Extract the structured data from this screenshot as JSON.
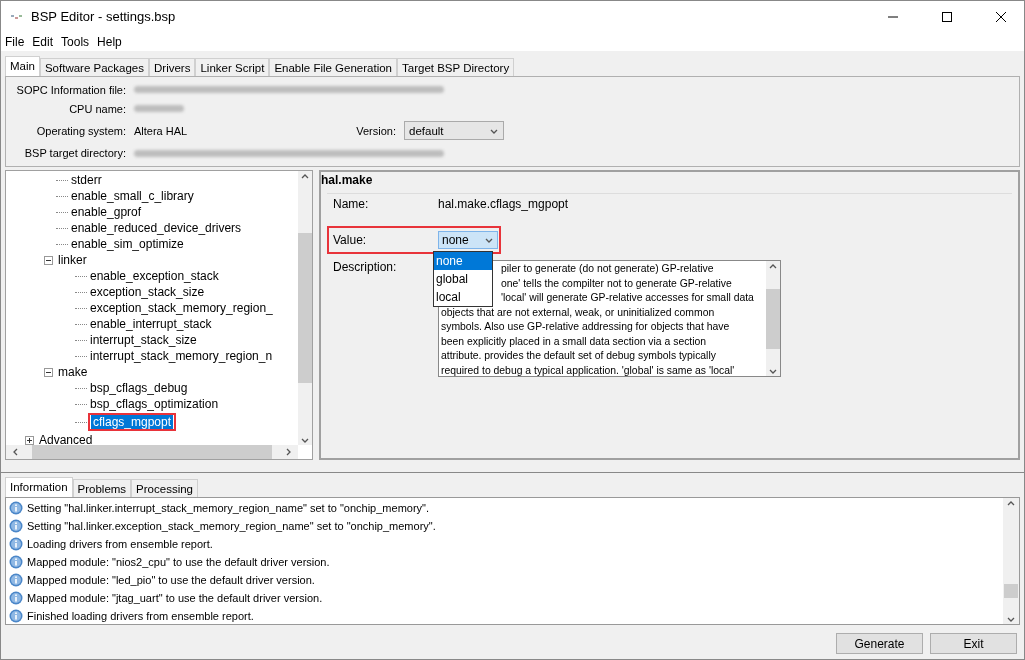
{
  "window": {
    "title": "BSP Editor - settings.bsp"
  },
  "menu": [
    "File",
    "Edit",
    "Tools",
    "Help"
  ],
  "tabs": [
    {
      "label": "Main",
      "selected": true
    },
    {
      "label": "Software Packages",
      "selected": false
    },
    {
      "label": "Drivers",
      "selected": false
    },
    {
      "label": "Linker Script",
      "selected": false
    },
    {
      "label": "Enable File Generation",
      "selected": false
    },
    {
      "label": "Target BSP Directory",
      "selected": false
    }
  ],
  "info": [
    {
      "label": "SOPC Information file:",
      "kind": "blurred"
    },
    {
      "label": "CPU name:",
      "kind": "blurred"
    },
    {
      "label": "Operating system:",
      "kind": "text",
      "value": "Altera HAL",
      "extra_label": "Version:",
      "extra_value": "default"
    },
    {
      "label": "BSP target directory:",
      "kind": "blurred"
    }
  ],
  "tree": {
    "scrolled_branch": [
      {
        "label": "stderr",
        "selected": false
      },
      {
        "label": "enable_small_c_library",
        "selected": false
      },
      {
        "label": "enable_gprof",
        "selected": false
      },
      {
        "label": "enable_reduced_device_drivers",
        "selected": false
      },
      {
        "label": "enable_sim_optimize",
        "selected": false
      },
      {
        "label": "linker",
        "selected": false,
        "expanded": true,
        "children": [
          {
            "label": "enable_exception_stack",
            "selected": false
          },
          {
            "label": "exception_stack_size",
            "selected": false
          },
          {
            "label": "exception_stack_memory_region_",
            "selected": false
          },
          {
            "label": "enable_interrupt_stack",
            "selected": false
          },
          {
            "label": "interrupt_stack_size",
            "selected": false
          },
          {
            "label": "interrupt_stack_memory_region_n",
            "selected": false
          }
        ]
      },
      {
        "label": "make",
        "selected": false,
        "expanded": true,
        "children": [
          {
            "label": "bsp_cflags_debug",
            "selected": false
          },
          {
            "label": "bsp_cflags_optimization",
            "selected": false
          },
          {
            "label": "cflags_mgpopt",
            "selected": true,
            "highlighted": true
          }
        ]
      }
    ],
    "roots": [
      {
        "label": "Advanced",
        "selected": false,
        "expanded": false
      }
    ]
  },
  "detail": {
    "group": "hal.make",
    "name_label": "Name:",
    "name": "hal.make.cflags_mgpopt",
    "value_label": "Value:",
    "value": "none",
    "value_highlighted": true,
    "options": [
      {
        "label": "none",
        "selected": true
      },
      {
        "label": "global",
        "selected": false
      },
      {
        "label": "local",
        "selected": false
      }
    ],
    "description_label": "Description:",
    "description_lines": [
      {
        "text": "piler to generate (do not generate) GP-relative",
        "partly_hidden": true
      },
      {
        "text": "one' tells the compilter not to generate GP-relative",
        "partly_hidden": true
      },
      {
        "text": "'local' will generate GP-relative accesses for small data",
        "partly_hidden": true
      },
      {
        "text": "objects that are not external, weak, or uninitialized common",
        "partly_hidden": false
      },
      {
        "text": "symbols. Also use GP-relative addressing for objects that have",
        "partly_hidden": false
      },
      {
        "text": "been explicitly placed in a small data section via a section",
        "partly_hidden": false
      },
      {
        "text": "attribute. provides the default set of debug symbols typically",
        "partly_hidden": false
      },
      {
        "text": "required to debug a typical application. 'global' is same as 'local'",
        "partly_hidden": false
      }
    ]
  },
  "bottom_tabs": [
    {
      "label": "Information",
      "selected": true
    },
    {
      "label": "Problems",
      "selected": false
    },
    {
      "label": "Processing",
      "selected": false
    }
  ],
  "log": [
    "Setting \"hal.linker.interrupt_stack_memory_region_name\" set to \"onchip_memory\".",
    "Setting \"hal.linker.exception_stack_memory_region_name\" set to \"onchip_memory\".",
    "Loading drivers from ensemble report.",
    "Mapped module: \"nios2_cpu\" to use the default driver version.",
    "Mapped module: \"led_pio\" to use the default driver version.",
    "Mapped module: \"jtag_uart\" to use the default driver version.",
    "Finished loading drivers from ensemble report."
  ],
  "buttons": [
    "Generate",
    "Exit"
  ]
}
